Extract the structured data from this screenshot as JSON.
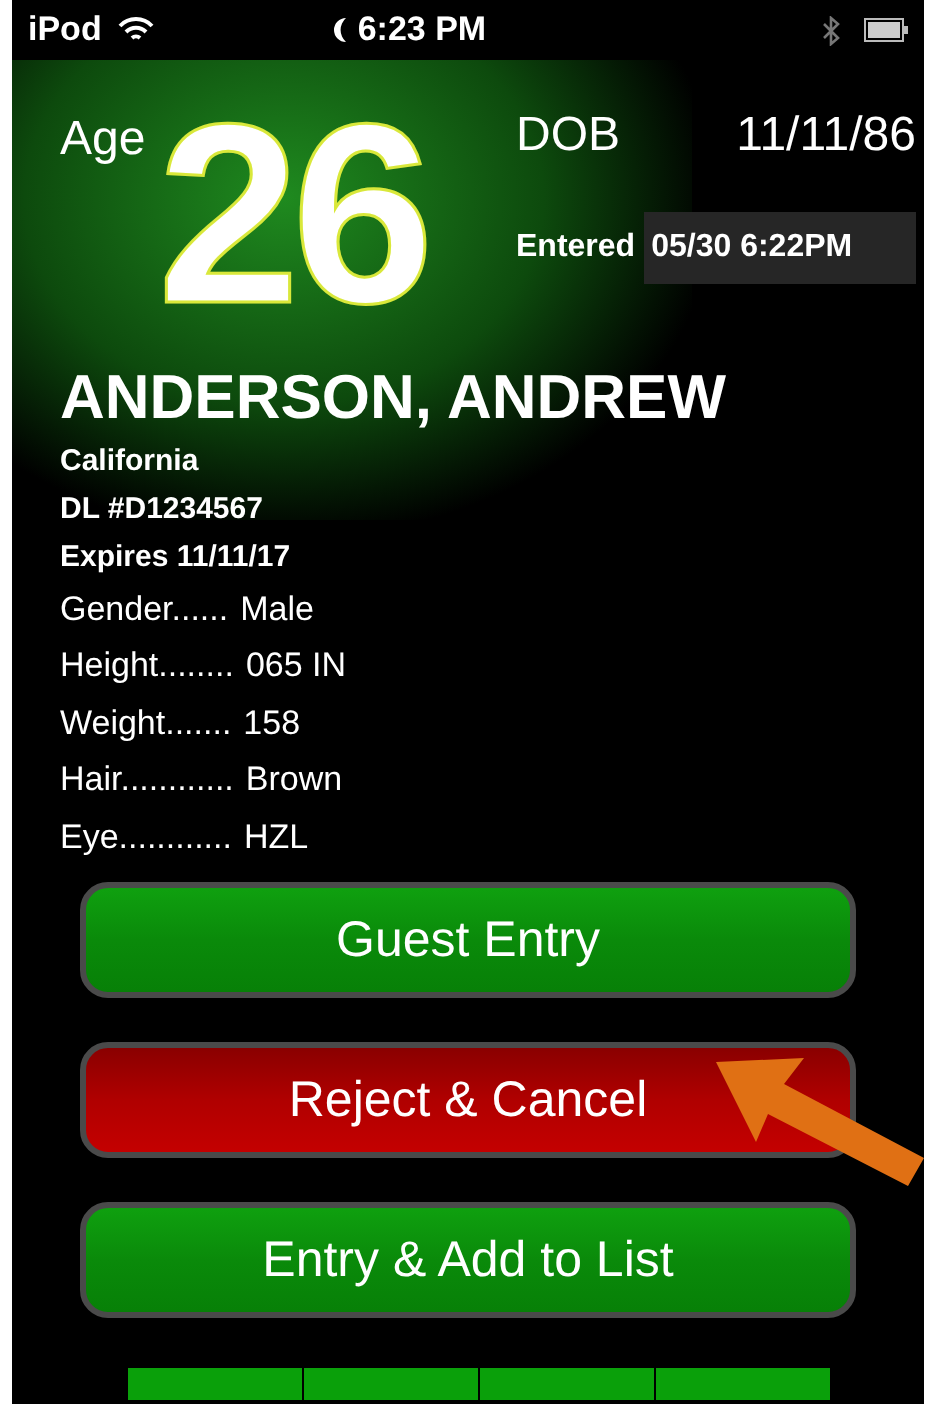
{
  "status_bar": {
    "carrier": "iPod",
    "time": "6:23 PM"
  },
  "age": {
    "label": "Age",
    "value": "26"
  },
  "dob": {
    "label": "DOB",
    "value": "11/11/86"
  },
  "entered": {
    "label": "Entered",
    "value": "05/30 6:22PM"
  },
  "name": "ANDERSON, ANDREW",
  "license": [
    "California",
    "DL #D1234567",
    "Expires 11/11/17"
  ],
  "details": [
    {
      "label": "Gender......",
      "value": "Male"
    },
    {
      "label": "Height........",
      "value": "065 IN"
    },
    {
      "label": "Weight.......",
      "value": "158"
    },
    {
      "label": "Hair............",
      "value": "Brown"
    },
    {
      "label": "Eye............",
      "value": "HZL"
    }
  ],
  "buttons": [
    {
      "label": "Guest Entry",
      "kind": "accept"
    },
    {
      "label": "Reject & Cancel",
      "kind": "reject"
    },
    {
      "label": "Entry & Add to List",
      "kind": "accept"
    }
  ]
}
